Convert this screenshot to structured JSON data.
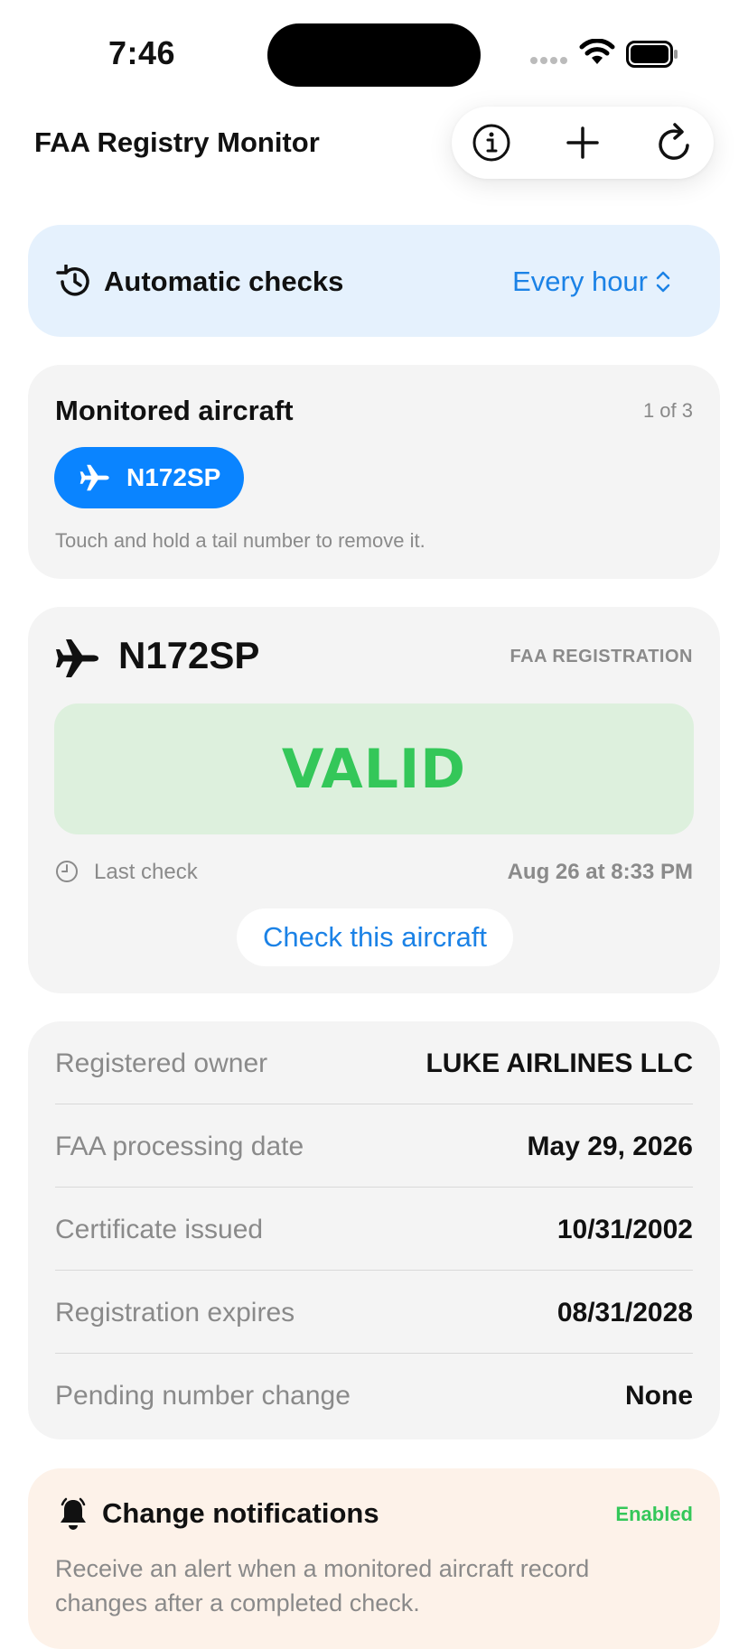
{
  "status_bar": {
    "time": "7:46"
  },
  "header": {
    "title": "FAA Registry Monitor",
    "actions": {
      "info_icon": "info-circle-icon",
      "add_icon": "plus-icon",
      "refresh_icon": "refresh-icon"
    }
  },
  "automatic_checks": {
    "label": "Automatic checks",
    "frequency": "Every hour"
  },
  "monitored": {
    "title": "Monitored aircraft",
    "count": "1 of 3",
    "tails": [
      "N172SP"
    ],
    "hint": "Touch and hold a tail number to remove it."
  },
  "aircraft": {
    "tail": "N172SP",
    "source": "FAA REGISTRATION",
    "status": "VALID",
    "last_check_label": "Last check",
    "last_check_value": "Aug 26 at 8:33 PM",
    "check_button": "Check this aircraft"
  },
  "details": [
    {
      "label": "Registered owner",
      "value": "LUKE AIRLINES LLC"
    },
    {
      "label": "FAA processing date",
      "value": "May 29, 2026"
    },
    {
      "label": "Certificate issued",
      "value": "10/31/2002"
    },
    {
      "label": "Registration expires",
      "value": "08/31/2028"
    },
    {
      "label": "Pending number change",
      "value": "None"
    }
  ],
  "notifications": {
    "title": "Change notifications",
    "status": "Enabled",
    "description": "Receive an alert when a monitored aircraft record changes after a completed check."
  },
  "colors": {
    "accent": "#1b82e6",
    "chip": "#0a84ff",
    "valid_green": "#34c759",
    "valid_bg": "#ddf0dd",
    "auto_bg": "#e5f1fd",
    "notif_bg": "#fdf2e9"
  }
}
